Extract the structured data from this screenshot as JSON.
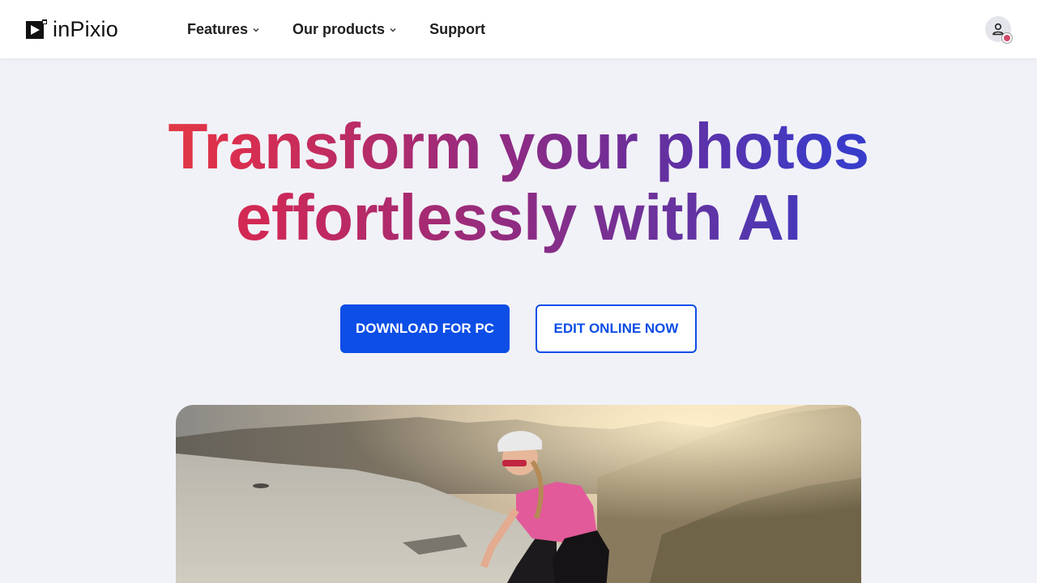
{
  "brand": {
    "name": "inPixio"
  },
  "nav": {
    "items": [
      {
        "label": "Features",
        "has_dropdown": true
      },
      {
        "label": "Our products",
        "has_dropdown": true
      },
      {
        "label": "Support",
        "has_dropdown": false
      }
    ]
  },
  "header": {
    "account_icon": "user-icon"
  },
  "hero": {
    "title_line1": "Transform your photos",
    "title_line2": "effortlessly with AI",
    "primary_cta": "DOWNLOAD FOR PC",
    "secondary_cta": "EDIT ONLINE NOW"
  },
  "colors": {
    "accent": "#0c4ee6",
    "background": "#f1f2f7",
    "gradient_start": "#ee5a2f",
    "gradient_end": "#1e3fd8"
  }
}
